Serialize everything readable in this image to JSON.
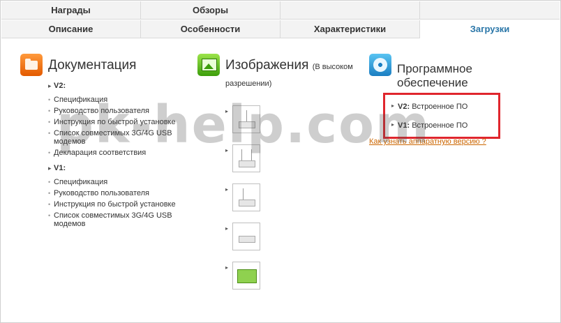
{
  "tabs": {
    "row1": [
      "Награды",
      "Обзоры",
      "",
      ""
    ],
    "row2": [
      "Описание",
      "Особенности",
      "Характеристики",
      "Загрузки"
    ]
  },
  "docs": {
    "title": "Документация",
    "v2_label": "V2:",
    "v2_items": [
      "Спецификация",
      "Руководство пользователя",
      "Инструкция по быстрой установке",
      "Список совместимых 3G/4G USB модемов",
      "Декларация соответствия"
    ],
    "v1_label": "V1:",
    "v1_items": [
      "Спецификация",
      "Руководство пользователя",
      "Инструкция по быстрой установке",
      "Список совместимых 3G/4G USB модемов"
    ]
  },
  "images": {
    "title": "Изображения",
    "subtitle": "(В высоком разрешении)"
  },
  "firmware": {
    "title": "Программное обеспечение",
    "v2_label": "V2:",
    "v2_text": "Встроенное ПО",
    "v1_label": "V1:",
    "v1_text": "Встроенное ПО",
    "help_link": "Как узнать аппаратную версию ?"
  },
  "watermark": "pk-help.com",
  "colors": {
    "active_tab": "#2a76a8",
    "highlight": "#e0262d",
    "link": "#cc6600"
  }
}
